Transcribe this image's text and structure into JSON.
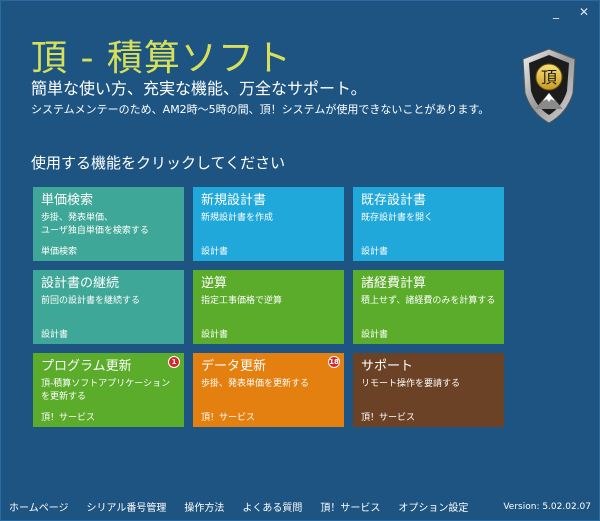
{
  "window": {
    "minimize_label": "_",
    "close_label": "✕"
  },
  "header": {
    "title": "頂 - 積算ソフト",
    "tagline": "簡単な使い方、充実な機能、万全なサポート。",
    "notice": "システムメンテーのため、AM2時～5時の間、頂！システムが使用できないことがあります。",
    "logo_char": "頂",
    "logo_icon": "shield-logo-icon"
  },
  "main": {
    "section_title": "使用する機能をクリックしてください",
    "tiles": [
      {
        "title": "単価検索",
        "desc": "歩掛、発表単価、\nユーザ独自単価を検索する",
        "footer": "単価検索",
        "color": "#3fa797"
      },
      {
        "title": "新規設計書",
        "desc": "新規設計書を作成",
        "footer": "設計書",
        "color": "#1fa8d9"
      },
      {
        "title": "既存設計書",
        "desc": "既存設計書を開く",
        "footer": "設計書",
        "color": "#1fa8d9"
      },
      {
        "title": "設計書の継続",
        "desc": "前回の設計書を継続する",
        "footer": "設計書",
        "color": "#3fa797"
      },
      {
        "title": "逆算",
        "desc": "指定工事価格で逆算",
        "footer": "設計書",
        "color": "#5aac2a"
      },
      {
        "title": "諸経費計算",
        "desc": "積上せず、諸経費のみを計算する",
        "footer": "設計書",
        "color": "#5aac2a"
      },
      {
        "title": "プログラム更新",
        "desc": "頂-積算ソフトアプリケーション\nを更新する",
        "footer": "頂！サービス",
        "badge": "1",
        "color": "#5aac2a"
      },
      {
        "title": "データ更新",
        "desc": "歩掛、発表単価を更新する",
        "footer": "頂！サービス",
        "badge": "18",
        "color": "#e38010"
      },
      {
        "title": "サポート",
        "desc": "リモート操作を要請する",
        "footer": "頂！サービス",
        "color": "#6b4226"
      }
    ]
  },
  "footer": {
    "links": [
      "ホームページ",
      "シリアル番号管理",
      "操作方法",
      "よくある質問",
      "頂！サービス",
      "オプション設定"
    ],
    "version": "Version: 5.02.02.07"
  }
}
